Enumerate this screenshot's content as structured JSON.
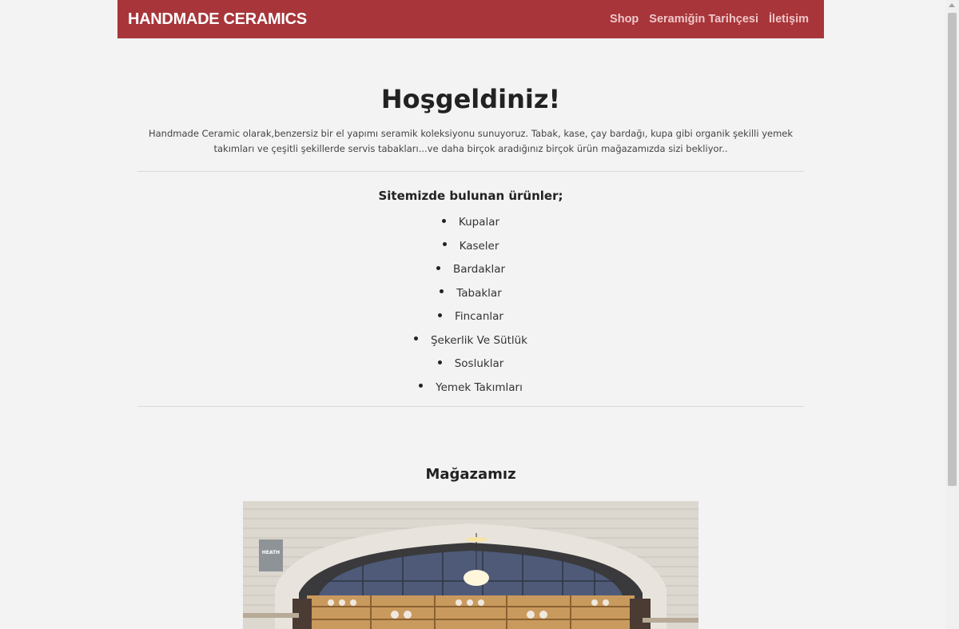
{
  "header": {
    "brand": "HANDMADE CERAMICS",
    "nav": [
      {
        "label": "Shop"
      },
      {
        "label": "Seramiğin Tarihçesi"
      },
      {
        "label": "İletişim"
      }
    ]
  },
  "main": {
    "welcome_title": "Hoşgeldiniz!",
    "intro_text": "Handmade Ceramic olarak,benzersiz bir el yapımı seramik koleksiyonu sunuyoruz. Tabak, kase, çay bardağı, kupa gibi organik şekilli yemek takımları ve çeşitli şekillerde servis tabakları...ve daha birçok aradığınız birçok ürün mağazamızda sizi bekliyor..",
    "products_heading": "Sitemizde bulunan ürünler;",
    "products": [
      "Kupalar",
      "Kaseler",
      "Bardaklar",
      "Tabaklar",
      "Fincanlar",
      "Şekerlik Ve Sütlük",
      "Sosluklar",
      "Yemek Takımları"
    ],
    "store_heading": "Mağazamız",
    "store_sign_text": "HEATH"
  },
  "colors": {
    "navbar": "#a7353a",
    "brand_text": "#ffffff",
    "nav_text": "#f0c7c9",
    "page_background": "#f3f3f3"
  }
}
